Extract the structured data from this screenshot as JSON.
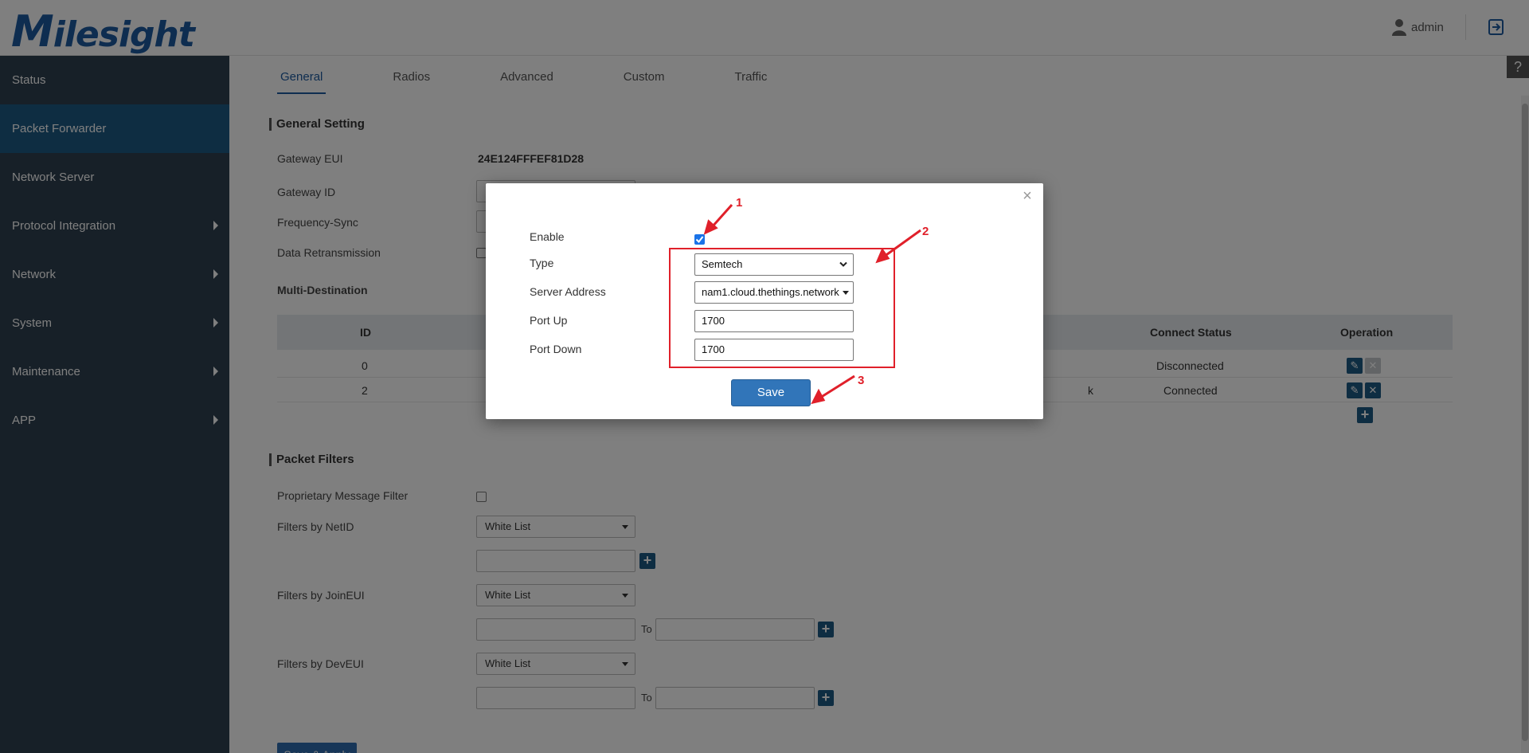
{
  "header": {
    "logo_initial": "M",
    "logo_rest": "ilesight",
    "user": "admin"
  },
  "sidebar": {
    "items": [
      {
        "label": "Status"
      },
      {
        "label": "Packet Forwarder"
      },
      {
        "label": "Network Server"
      },
      {
        "label": "Protocol Integration"
      },
      {
        "label": "Network"
      },
      {
        "label": "System"
      },
      {
        "label": "Maintenance"
      },
      {
        "label": "APP"
      }
    ]
  },
  "tabs": [
    "General",
    "Radios",
    "Advanced",
    "Custom",
    "Traffic"
  ],
  "general_setting": {
    "title": "General Setting",
    "gateway_eui_label": "Gateway EUI",
    "gateway_eui_value": "24E124FFFEF81D28",
    "gateway_id_label": "Gateway ID",
    "frequency_sync_label": "Frequency-Sync",
    "data_retransmission_label": "Data Retransmission",
    "multi_destination_label": "Multi-Destination"
  },
  "table": {
    "headers": {
      "id": "ID",
      "connect_status": "Connect Status",
      "operation": "Operation"
    },
    "rows": [
      {
        "id": "0",
        "address_tail": "",
        "status": "Disconnected"
      },
      {
        "id": "2",
        "address_tail": "k",
        "status": "Connected"
      }
    ]
  },
  "packet_filters": {
    "title": "Packet Filters",
    "proprietary_label": "Proprietary Message Filter",
    "netid_label": "Filters by NetID",
    "netid_mode": "White List",
    "joineui_label": "Filters by JoinEUI",
    "joineui_mode": "White List",
    "deveui_label": "Filters by DevEUI",
    "deveui_mode": "White List",
    "to_label": "To"
  },
  "main_apply_label": "Save & Apply",
  "help_label": "?",
  "modal": {
    "close": "×",
    "enable_label": "Enable",
    "enable_checked": true,
    "type_label": "Type",
    "type_value": "Semtech",
    "server_address_label": "Server Address",
    "server_address_value": "nam1.cloud.thethings.network",
    "port_up_label": "Port Up",
    "port_up_value": "1700",
    "port_down_label": "Port Down",
    "port_down_value": "1700",
    "save_label": "Save"
  },
  "annotations": [
    "1",
    "2",
    "3"
  ],
  "colors": {
    "brand": "#1d5ba0",
    "sidebar": "#2f4150",
    "sidebar_active": "#1d5a84",
    "annotation": "#e0202a",
    "save_button": "#3175b9"
  }
}
